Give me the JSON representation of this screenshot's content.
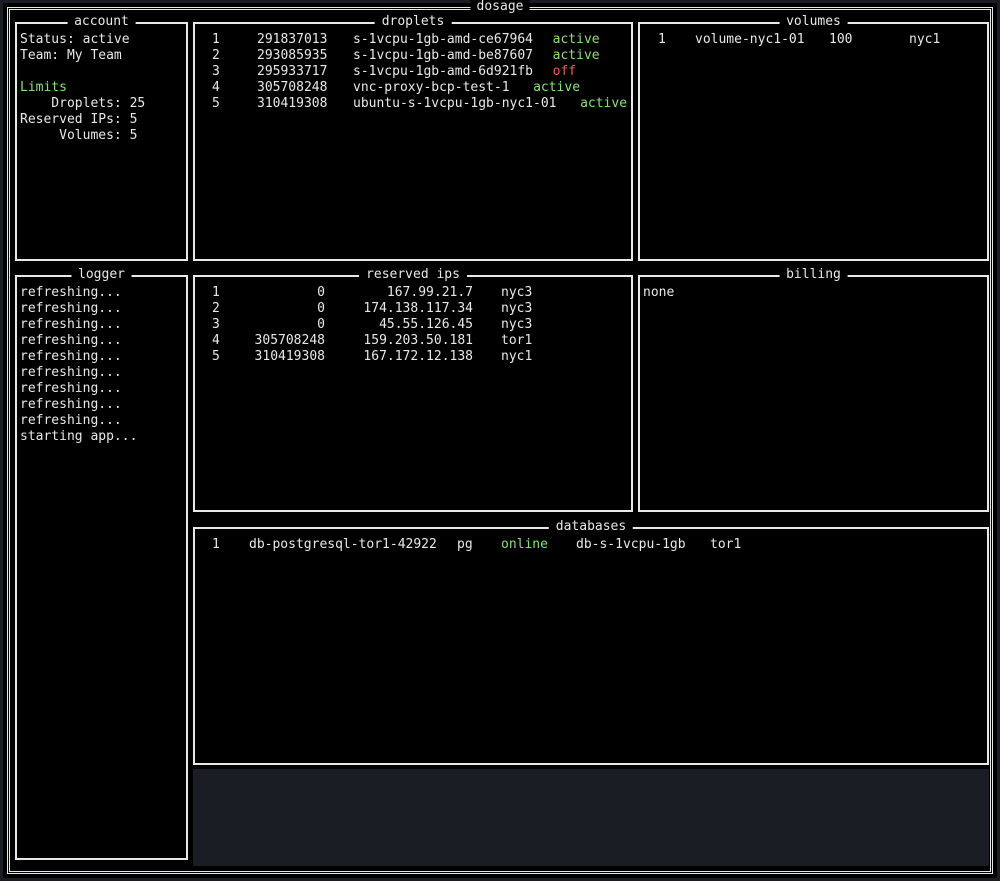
{
  "app_title": "dosage",
  "colors": {
    "green": "#8ee07a",
    "red": "#ef5b5b",
    "text": "#e8e8e8",
    "background": "#000000"
  },
  "account": {
    "title": "account",
    "status": "Status: active",
    "team": "Team: My Team",
    "limits_heading": "Limits",
    "limits": [
      "    Droplets: 25",
      "Reserved IPs: 5",
      "     Volumes: 5"
    ]
  },
  "droplets": {
    "title": "droplets",
    "rows": [
      {
        "idx": "1",
        "id": "291837013",
        "name": "s-1vcpu-1gb-amd-ce67964",
        "status": "active"
      },
      {
        "idx": "2",
        "id": "293085935",
        "name": "s-1vcpu-1gb-amd-be87607",
        "status": "active"
      },
      {
        "idx": "3",
        "id": "295933717",
        "name": "s-1vcpu-1gb-amd-6d921fb",
        "status": "off"
      },
      {
        "idx": "4",
        "id": "305708248",
        "name": "vnc-proxy-bcp-test-1",
        "status": "active"
      },
      {
        "idx": "5",
        "id": "310419308",
        "name": "ubuntu-s-1vcpu-1gb-nyc1-01",
        "status": "active"
      }
    ]
  },
  "volumes": {
    "title": "volumes",
    "rows": [
      {
        "idx": "1",
        "name": "volume-nyc1-01",
        "size": "100",
        "region": "nyc1"
      }
    ]
  },
  "logger": {
    "title": "logger",
    "lines": [
      "refreshing...",
      "refreshing...",
      "refreshing...",
      "refreshing...",
      "refreshing...",
      "refreshing...",
      "refreshing...",
      "refreshing...",
      "refreshing...",
      "starting app..."
    ]
  },
  "reserved_ips": {
    "title": "reserved ips",
    "rows": [
      {
        "idx": "1",
        "droplet": "0",
        "ip": "167.99.21.7",
        "region": "nyc3"
      },
      {
        "idx": "2",
        "droplet": "0",
        "ip": "174.138.117.34",
        "region": "nyc3"
      },
      {
        "idx": "3",
        "droplet": "0",
        "ip": "45.55.126.45",
        "region": "nyc3"
      },
      {
        "idx": "4",
        "droplet": "305708248",
        "ip": "159.203.50.181",
        "region": "tor1"
      },
      {
        "idx": "5",
        "droplet": "310419308",
        "ip": "167.172.12.138",
        "region": "nyc1"
      }
    ]
  },
  "billing": {
    "title": "billing",
    "text": "none"
  },
  "databases": {
    "title": "databases",
    "rows": [
      {
        "idx": "1",
        "name": "db-postgresql-tor1-42922",
        "engine": "pg",
        "status": "online",
        "size": "db-s-1vcpu-1gb",
        "region": "tor1"
      }
    ]
  }
}
